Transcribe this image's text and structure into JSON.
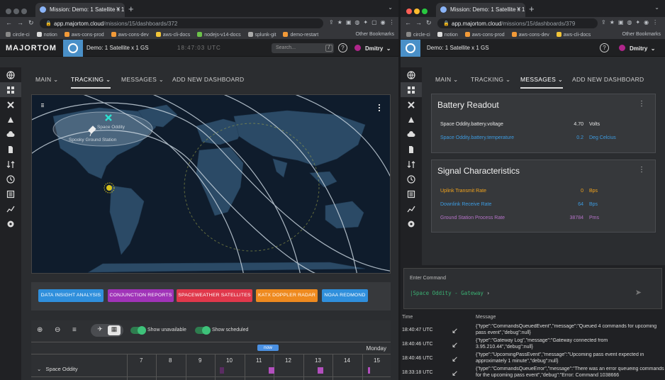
{
  "left": {
    "tab_title": "Mission: Demo: 1 Satellite x 1 G",
    "url_host": "app.majortom.cloud",
    "url_path": "/missions/15/dashboards/372",
    "bookmarks": [
      "circle-ci",
      "notion",
      "aws-cons-prod",
      "aws-cons-dev",
      "aws-cli-docs",
      "nodejs-v14-docs",
      "splunk-git",
      "demo-restart"
    ],
    "bookmark_other": "Other Bookmarks",
    "logo": "MAJORTOM",
    "mission": "Demo: 1 Satellite x 1 GS",
    "clock": "18:47:03 UTC",
    "search_placeholder": "Search...",
    "search_key": "/",
    "user": "Dmitry",
    "nav": [
      "MAIN",
      "TRACKING",
      "MESSAGES",
      "ADD NEW DASHBOARD"
    ],
    "map": {
      "satellite_label": "Space Oddity",
      "station_label": "Spooky Ground Station"
    },
    "chips": [
      {
        "label": "DATA INSIGHT ANALYSIS",
        "color": "#2f8fdc"
      },
      {
        "label": "CONJUNCTION REPORTS",
        "color": "#a033b8"
      },
      {
        "label": "SPACEWEATHER SATELLITES",
        "color": "#e0384b"
      },
      {
        "label": "KATX DOPPLER RADAR",
        "color": "#ee8a1f"
      },
      {
        "label": "NOAA REDMOND",
        "color": "#2f8fdc"
      }
    ],
    "timeline": {
      "show_unavailable": "Show unavailable",
      "show_scheduled": "Show scheduled",
      "now": "now",
      "month": "Monday",
      "days": [
        "7",
        "8",
        "9",
        "10",
        "11",
        "12",
        "13",
        "14",
        "15"
      ],
      "satellite": "Space Oddity"
    }
  },
  "right": {
    "tab_title": "Mission: Demo: 1 Satellite x 1 G",
    "url_host": "app.majortom.cloud",
    "url_path": "/missions/15/dashboards/379",
    "bookmarks": [
      "circle-ci",
      "notion",
      "aws-cons-prod",
      "aws-cons-dev",
      "aws-cli-docs"
    ],
    "bookmark_other": "Other Bookmarks",
    "mission": "Demo: 1 Satellite x 1 GS",
    "user": "Dmitry",
    "nav": [
      "MAIN",
      "TRACKING",
      "MESSAGES",
      "ADD NEW DASHBOARD"
    ],
    "battery": {
      "title": "Battery Readout",
      "rows": [
        {
          "name": "Space Oddity.battery.voltage",
          "value": "4.70",
          "unit": "Volts",
          "color": "#e6e6e6"
        },
        {
          "name": "Space Oddity.battery.temperature",
          "value": "0.2",
          "unit": "Deg Celcius",
          "color": "#3d9be0"
        }
      ]
    },
    "signal": {
      "title": "Signal Characteristics",
      "rows": [
        {
          "name": "Uplink Transmit Rate",
          "value": "0",
          "unit": "Bps",
          "color": "#f2a31c"
        },
        {
          "name": "Downlink Receive Rate",
          "value": "64",
          "unit": "Bps",
          "color": "#3d9be0"
        },
        {
          "name": "Ground Station Process Rate",
          "value": "38784",
          "unit": "Pms",
          "color": "#b673c9"
        }
      ]
    },
    "command": {
      "label": "Enter Command",
      "prompt": "|Space Oddity - Gateway"
    },
    "log": {
      "col_time": "Time",
      "col_message": "Message",
      "rows": [
        {
          "time": "18:40:47 UTC",
          "message": "{\"type\":\"CommandsQueuedEvent\",\"message\":\"Queued 4 commands for upcoming pass event\",\"debug\":null}"
        },
        {
          "time": "18:40:46 UTC",
          "message": "{\"type\":\"Gateway Log\",\"message\":\"Gateway connected from 3.95.210.44\",\"debug\":null}"
        },
        {
          "time": "18:40:46 UTC",
          "message": "{\"type\":\"UpcomingPassEvent\",\"message\":\"Upcoming pass event expected in approximately 1 minute\",\"debug\":null}"
        },
        {
          "time": "18:33:18 UTC",
          "message": "{\"type\":\"CommandsQueueError\",\"message\":\"There was an error queueing commands for the upcoming pass event\",\"debug\":\"Error: Command 1038666"
        }
      ]
    }
  }
}
